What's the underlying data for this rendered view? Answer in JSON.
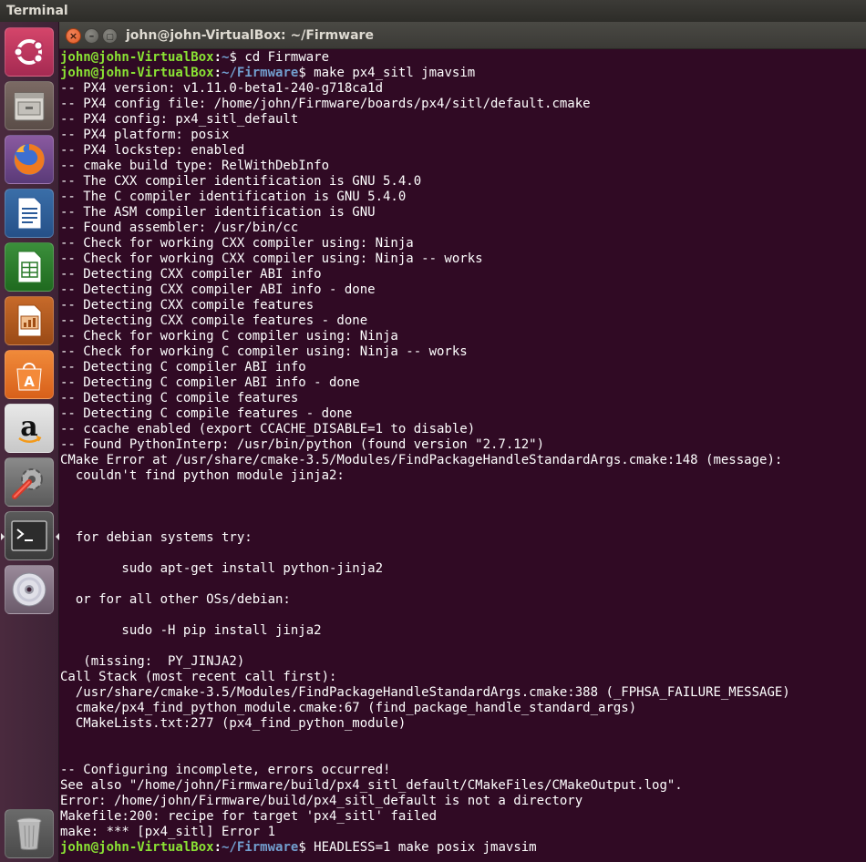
{
  "topbar": {
    "app_name": "Terminal"
  },
  "window": {
    "title": "john@john-VirtualBox: ~/Firmware"
  },
  "launcher": {
    "items": [
      {
        "name": "ubuntu-dash-icon"
      },
      {
        "name": "files-icon"
      },
      {
        "name": "firefox-icon"
      },
      {
        "name": "libreoffice-writer-icon"
      },
      {
        "name": "libreoffice-calc-icon"
      },
      {
        "name": "libreoffice-impress-icon"
      },
      {
        "name": "ubuntu-software-icon"
      },
      {
        "name": "amazon-icon"
      },
      {
        "name": "system-settings-icon"
      },
      {
        "name": "terminal-icon",
        "active": true
      },
      {
        "name": "dvd-icon"
      },
      {
        "name": "trash-icon"
      }
    ]
  },
  "colors": {
    "terminal_bg": "#300a24",
    "prompt_user": "#8ae234",
    "prompt_path": "#729fcf",
    "text": "#ffffff",
    "launcher_bg": "#4a2a3e"
  },
  "terminal": {
    "prompt_user": "john@john-VirtualBox",
    "prompt_path_home": "~",
    "prompt_path_firmware": "~/Firmware",
    "cmd1": " cd Firmware",
    "cmd2": " make px4_sitl jmavsim",
    "cmd_last": " HEADLESS=1 make posix jmavsim",
    "output_lines": [
      "-- PX4 version: v1.11.0-beta1-240-g718ca1d",
      "-- PX4 config file: /home/john/Firmware/boards/px4/sitl/default.cmake",
      "-- PX4 config: px4_sitl_default",
      "-- PX4 platform: posix",
      "-- PX4 lockstep: enabled",
      "-- cmake build type: RelWithDebInfo",
      "-- The CXX compiler identification is GNU 5.4.0",
      "-- The C compiler identification is GNU 5.4.0",
      "-- The ASM compiler identification is GNU",
      "-- Found assembler: /usr/bin/cc",
      "-- Check for working CXX compiler using: Ninja",
      "-- Check for working CXX compiler using: Ninja -- works",
      "-- Detecting CXX compiler ABI info",
      "-- Detecting CXX compiler ABI info - done",
      "-- Detecting CXX compile features",
      "-- Detecting CXX compile features - done",
      "-- Check for working C compiler using: Ninja",
      "-- Check for working C compiler using: Ninja -- works",
      "-- Detecting C compiler ABI info",
      "-- Detecting C compiler ABI info - done",
      "-- Detecting C compile features",
      "-- Detecting C compile features - done",
      "-- ccache enabled (export CCACHE_DISABLE=1 to disable)",
      "-- Found PythonInterp: /usr/bin/python (found version \"2.7.12\")",
      "CMake Error at /usr/share/cmake-3.5/Modules/FindPackageHandleStandardArgs.cmake:148 (message):",
      "  couldn't find python module jinja2:",
      "",
      "",
      "",
      "  for debian systems try:",
      "",
      "        sudo apt-get install python-jinja2",
      "",
      "  or for all other OSs/debian:",
      "",
      "        sudo -H pip install jinja2",
      "",
      "   (missing:  PY_JINJA2)",
      "Call Stack (most recent call first):",
      "  /usr/share/cmake-3.5/Modules/FindPackageHandleStandardArgs.cmake:388 (_FPHSA_FAILURE_MESSAGE)",
      "  cmake/px4_find_python_module.cmake:67 (find_package_handle_standard_args)",
      "  CMakeLists.txt:277 (px4_find_python_module)",
      "",
      "",
      "-- Configuring incomplete, errors occurred!",
      "See also \"/home/john/Firmware/build/px4_sitl_default/CMakeFiles/CMakeOutput.log\".",
      "Error: /home/john/Firmware/build/px4_sitl_default is not a directory",
      "Makefile:200: recipe for target 'px4_sitl' failed",
      "make: *** [px4_sitl] Error 1"
    ]
  }
}
